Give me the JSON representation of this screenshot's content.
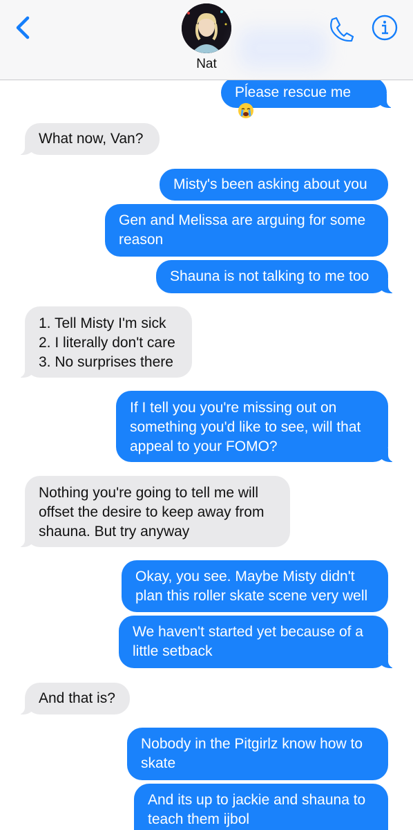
{
  "header": {
    "contact_name": "Nat",
    "back_icon": "chevron-left-icon",
    "call_icon": "phone-icon",
    "info_icon": "info-icon",
    "accent_color": "#147efb"
  },
  "messages": [
    {
      "direction": "sent",
      "text": "Pĺease rescue me",
      "emoji": "crying-face-icon"
    },
    {
      "direction": "received",
      "text": "What now, Van?"
    },
    {
      "direction": "sent",
      "text": "Misty's been asking about you"
    },
    {
      "direction": "sent",
      "text": "Gen and Melissa are arguing for some reason"
    },
    {
      "direction": "sent",
      "text": "Shauna is not talking to me too"
    },
    {
      "direction": "received",
      "lines": [
        "1. Tell Misty I'm sick",
        "2. I literally don't care",
        "3. No surprises there"
      ]
    },
    {
      "direction": "sent",
      "text": "If I tell you you're missing out on something you'd like to see, will that appeal to your FOMO?"
    },
    {
      "direction": "received",
      "text": "Nothing you're going to tell me will offset the desire to keep away from shauna. But try anyway"
    },
    {
      "direction": "sent",
      "text": "Okay, you see. Maybe Misty didn't plan this roller skate scene very well"
    },
    {
      "direction": "sent",
      "text": "We haven't started yet because of a little setback"
    },
    {
      "direction": "received",
      "text": "And that is?"
    },
    {
      "direction": "sent",
      "text": "Nobody in the Pitgirlz know how to skate"
    },
    {
      "direction": "sent",
      "text": "And its up to jackie and shauna to teach them ijbol"
    }
  ],
  "colors": {
    "sent_bubble": "#1a82fb",
    "received_bubble": "#e9e9eb",
    "header_bg": "#f7f7f8"
  }
}
